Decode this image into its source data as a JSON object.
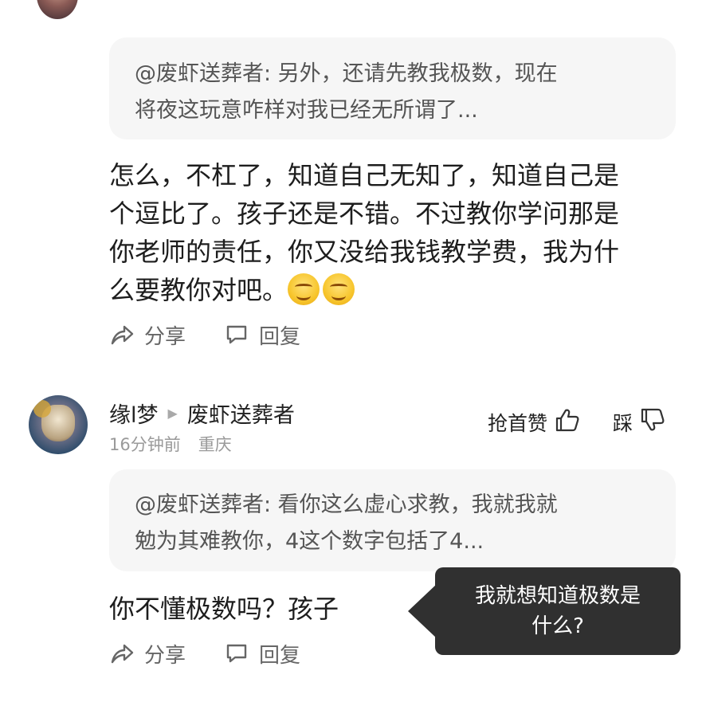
{
  "comment1": {
    "quote_lines": [
      "@废虾送葬者: 另外，还请先教我极数，现在",
      "将夜这玩意咋样对我已经无所谓了..."
    ],
    "body_lines": [
      "怎么，不杠了，知道自己无知了，知道自己是",
      "个逗比了。孩子还是不错。不过教你学问那是",
      "你老师的责任，你又没给我钱教学费，我为什",
      "么要教你对吧。"
    ],
    "emoji_icons": [
      "grin-emoji",
      "grin-emoji"
    ],
    "share_label": "分享",
    "reply_label": "回复"
  },
  "comment2": {
    "username": "缘l梦",
    "reply_to": "废虾送葬者",
    "time": "16分钟前",
    "location": "重庆",
    "grab_like_label": "抢首赞",
    "dislike_label": "踩",
    "quote_lines": [
      "@废虾送葬者: 看你这么虚心求教，我就我就",
      "勉为其难教你，4这个数字包括了4..."
    ],
    "body": "你不懂极数吗？孩子",
    "share_label": "分享",
    "reply_label": "回复"
  },
  "tooltip": {
    "lines": [
      "我就想知道极数是",
      "什么?"
    ]
  },
  "colors": {
    "quote_bg": "#f6f6f6",
    "tooltip_bg": "#303030",
    "meta_text": "#9a9a9a"
  }
}
